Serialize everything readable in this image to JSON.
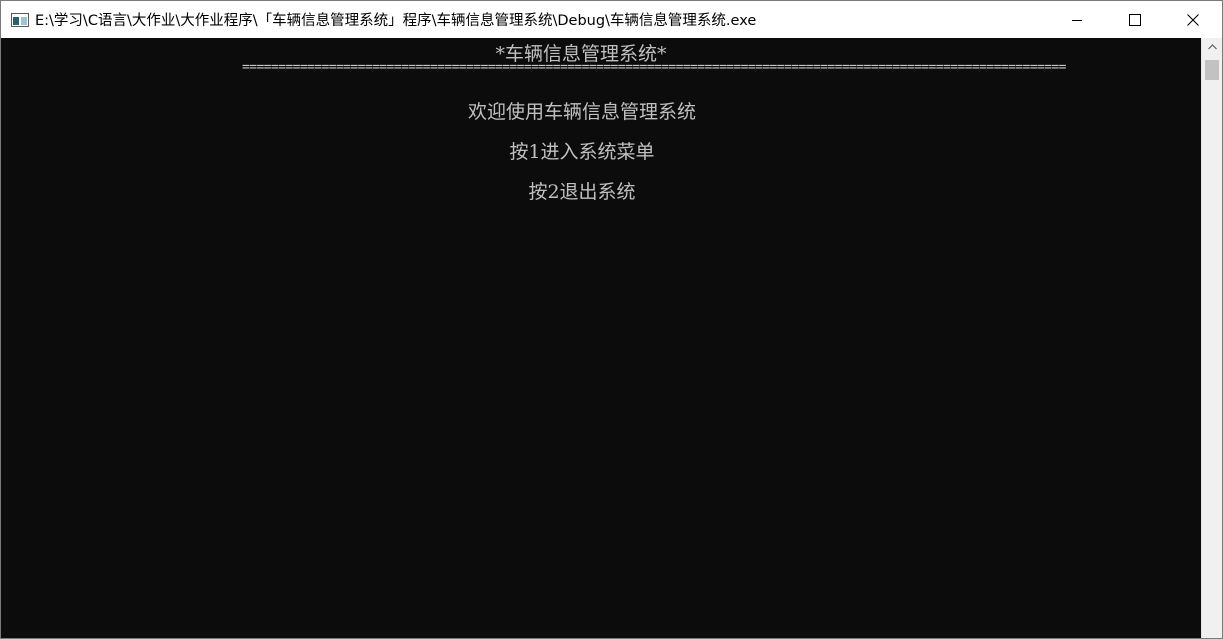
{
  "window": {
    "title": "E:\\学习\\C语言\\大作业\\大作业程序\\「车辆信息管理系统」程序\\车辆信息管理系统\\Debug\\车辆信息管理系统.exe",
    "app_icon": "console-app-icon",
    "controls": {
      "minimize_icon": "minimize-icon",
      "maximize_icon": "maximize-icon",
      "close_icon": "close-icon"
    }
  },
  "console": {
    "header_title": "*车辆信息管理系统*",
    "separator": "==================================================================================================================",
    "welcome": "欢迎使用车辆信息管理系统",
    "option_enter": "按1进入系统菜单",
    "option_exit": "按2退出系统",
    "foreground_color": "#c0c0c0",
    "background_color": "#0c0c0c"
  },
  "scrollbar": {
    "up_arrow_icon": "scroll-up-arrow-icon"
  }
}
